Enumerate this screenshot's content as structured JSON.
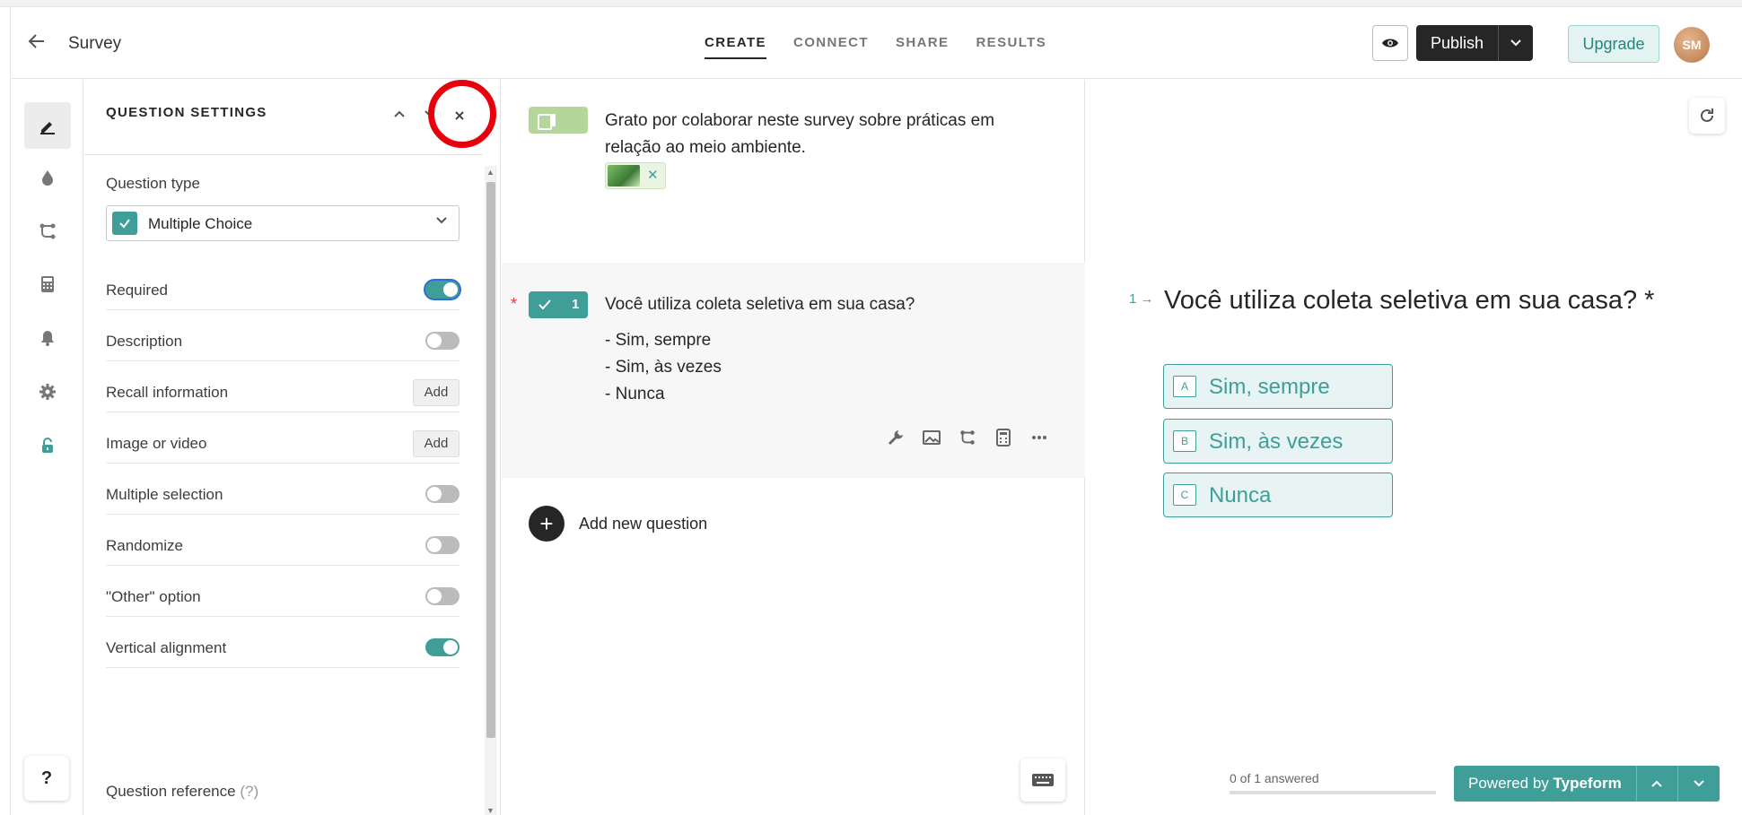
{
  "header": {
    "title": "Survey",
    "tabs": [
      "CREATE",
      "CONNECT",
      "SHARE",
      "RESULTS"
    ],
    "active_tab": "CREATE",
    "publish_label": "Publish",
    "upgrade_label": "Upgrade",
    "avatar_initials": "SM"
  },
  "rail": {
    "icons": [
      "pen-icon",
      "drop-icon",
      "logic-icon",
      "calculator-icon",
      "bell-icon",
      "gear-icon",
      "lock-icon"
    ],
    "help_label": "?"
  },
  "settings": {
    "title": "QUESTION SETTINGS",
    "question_type_label": "Question type",
    "question_type_value": "Multiple Choice",
    "rows": [
      {
        "label": "Required",
        "control": "toggle",
        "on": true
      },
      {
        "label": "Description",
        "control": "toggle",
        "on": false
      },
      {
        "label": "Recall information",
        "control": "add",
        "button": "Add"
      },
      {
        "label": "Image or video",
        "control": "add",
        "button": "Add"
      },
      {
        "label": "Multiple selection",
        "control": "toggle",
        "on": false
      },
      {
        "label": "Randomize",
        "control": "toggle",
        "on": false
      },
      {
        "label": "\"Other\" option",
        "control": "toggle",
        "on": false
      },
      {
        "label": "Vertical alignment",
        "control": "toggle",
        "on": true
      }
    ],
    "question_reference_label": "Question reference",
    "question_reference_hint": "(?)"
  },
  "questions": {
    "welcome_text": "Grato por colaborar neste survey sobre práticas em relação ao meio ambiente.",
    "q1": {
      "number": "1",
      "text": "Você utiliza coleta seletiva em sua casa?",
      "choices": [
        "- Sim, sempre",
        "- Sim, às vezes",
        "- Nunca"
      ],
      "required_mark": "*"
    },
    "add_new_label": "Add new question"
  },
  "preview": {
    "number": "1",
    "question": "Você utiliza coleta seletiva em sua casa? *",
    "choices": [
      {
        "key": "A",
        "label": "Sim, sempre"
      },
      {
        "key": "B",
        "label": "Sim, às vezes"
      },
      {
        "key": "C",
        "label": "Nunca"
      }
    ],
    "progress_text": "0 of 1 answered",
    "progress": 0,
    "powered_prefix": "Powered by",
    "powered_brand": "Typeform"
  },
  "colors": {
    "accent": "#3f9e98",
    "welcome_badge": "#b5d69a",
    "highlight_circle": "#e8000b"
  }
}
